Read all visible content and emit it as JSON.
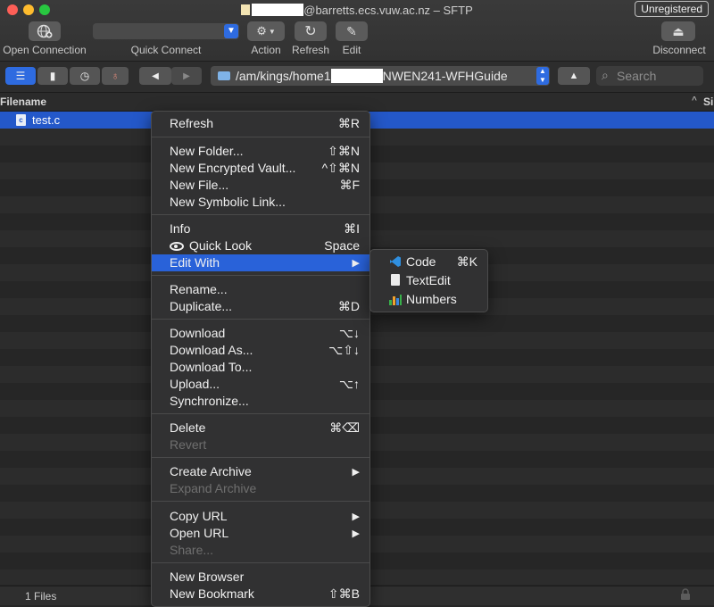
{
  "window": {
    "title_suffix": "@barretts.ecs.vuw.ac.nz – SFTP",
    "registration_badge": "Unregistered"
  },
  "toolbar": {
    "open_connection": "Open Connection",
    "quick_connect": "Quick Connect",
    "action": "Action",
    "refresh": "Refresh",
    "edit": "Edit",
    "disconnect": "Disconnect"
  },
  "navbar": {
    "path_prefix": "/am/kings/home1",
    "path_suffix": "NWEN241-WFHGuide",
    "search_placeholder": "Search"
  },
  "table": {
    "col_filename": "Filename",
    "col_size_partial": "Si",
    "files": [
      {
        "name": "test.c"
      }
    ]
  },
  "status": {
    "file_count": "1 Files"
  },
  "context_menu": {
    "refresh": {
      "label": "Refresh",
      "shortcut": "⌘R"
    },
    "new_folder": {
      "label": "New Folder...",
      "shortcut": "⇧⌘N"
    },
    "new_encrypted_vault": {
      "label": "New Encrypted Vault...",
      "shortcut": "^⇧⌘N"
    },
    "new_file": {
      "label": "New File...",
      "shortcut": "⌘F"
    },
    "new_symbolic_link": {
      "label": "New Symbolic Link..."
    },
    "info": {
      "label": "Info",
      "shortcut": "⌘I"
    },
    "quick_look": {
      "label": "Quick Look",
      "shortcut": "Space"
    },
    "edit_with": {
      "label": "Edit With",
      "shortcut": "▶"
    },
    "rename": {
      "label": "Rename..."
    },
    "duplicate": {
      "label": "Duplicate...",
      "shortcut": "⌘D"
    },
    "download": {
      "label": "Download",
      "shortcut": "⌥↓"
    },
    "download_as": {
      "label": "Download As...",
      "shortcut": "⌥⇧↓"
    },
    "download_to": {
      "label": "Download To..."
    },
    "upload": {
      "label": "Upload...",
      "shortcut": "⌥↑"
    },
    "synchronize": {
      "label": "Synchronize..."
    },
    "delete": {
      "label": "Delete",
      "shortcut": "⌘⌫"
    },
    "revert": {
      "label": "Revert"
    },
    "create_archive": {
      "label": "Create Archive",
      "shortcut": "▶"
    },
    "expand_archive": {
      "label": "Expand Archive"
    },
    "copy_url": {
      "label": "Copy URL",
      "shortcut": "▶"
    },
    "open_url": {
      "label": "Open URL",
      "shortcut": "▶"
    },
    "share": {
      "label": "Share..."
    },
    "new_browser": {
      "label": "New Browser"
    },
    "new_bookmark": {
      "label": "New Bookmark",
      "shortcut": "⇧⌘B"
    }
  },
  "submenu": {
    "code": {
      "label": "Code",
      "shortcut": "⌘K"
    },
    "textedit": {
      "label": "TextEdit"
    },
    "numbers": {
      "label": "Numbers"
    }
  },
  "colors": {
    "accent": "#2962d9",
    "selection": "#2458c9",
    "background": "#262626"
  }
}
